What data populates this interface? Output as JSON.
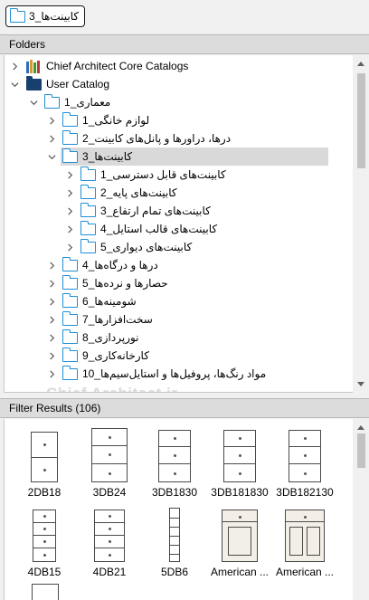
{
  "breadcrumb": {
    "label": "کابینت‌ها_3"
  },
  "folders_panel": {
    "title": "Folders"
  },
  "results_panel": {
    "title": "Filter Results (106)"
  },
  "watermark": {
    "text": "Chief Architect.ir"
  },
  "tree": {
    "core": {
      "label": "Chief Architect Core Catalogs"
    },
    "user": {
      "label": "User Catalog"
    },
    "arch": {
      "label": "معماری_1"
    },
    "items": [
      {
        "label": "لوازم خانگی_1"
      },
      {
        "label": "درها، دراورها و پانل‌های کابینت_2"
      },
      {
        "label": "کابینت‌ها_3"
      },
      {
        "label": "کابینت‌های قابل دسترسی_1"
      },
      {
        "label": "کابینت‌های پایه_2"
      },
      {
        "label": "کابینت‌های تمام ارتفاع_3"
      },
      {
        "label": "کابینت‌های قالب استایل_4"
      },
      {
        "label": "کابینت‌های دیواری_5"
      },
      {
        "label": "درها و درگاه‌ها_4"
      },
      {
        "label": "حصارها و نرده‌ها_5"
      },
      {
        "label": "شومینه‌ها_6"
      },
      {
        "label": "سخت‌افزارها_7"
      },
      {
        "label": "نورپردازی_8"
      },
      {
        "label": "کارخانه‌کاری_9"
      },
      {
        "label": "مواد رنگ‌ها، پروفیل‌ها و استایل‌سیم‌ها_10"
      }
    ]
  },
  "results": {
    "tiles": [
      {
        "caption": "2DB18"
      },
      {
        "caption": "3DB24"
      },
      {
        "caption": "3DB1830"
      },
      {
        "caption": "3DB181830"
      },
      {
        "caption": "3DB182130"
      },
      {
        "caption": "4DB15"
      },
      {
        "caption": "4DB21"
      },
      {
        "caption": "5DB6"
      },
      {
        "caption": "American ..."
      },
      {
        "caption": "American ..."
      }
    ]
  }
}
